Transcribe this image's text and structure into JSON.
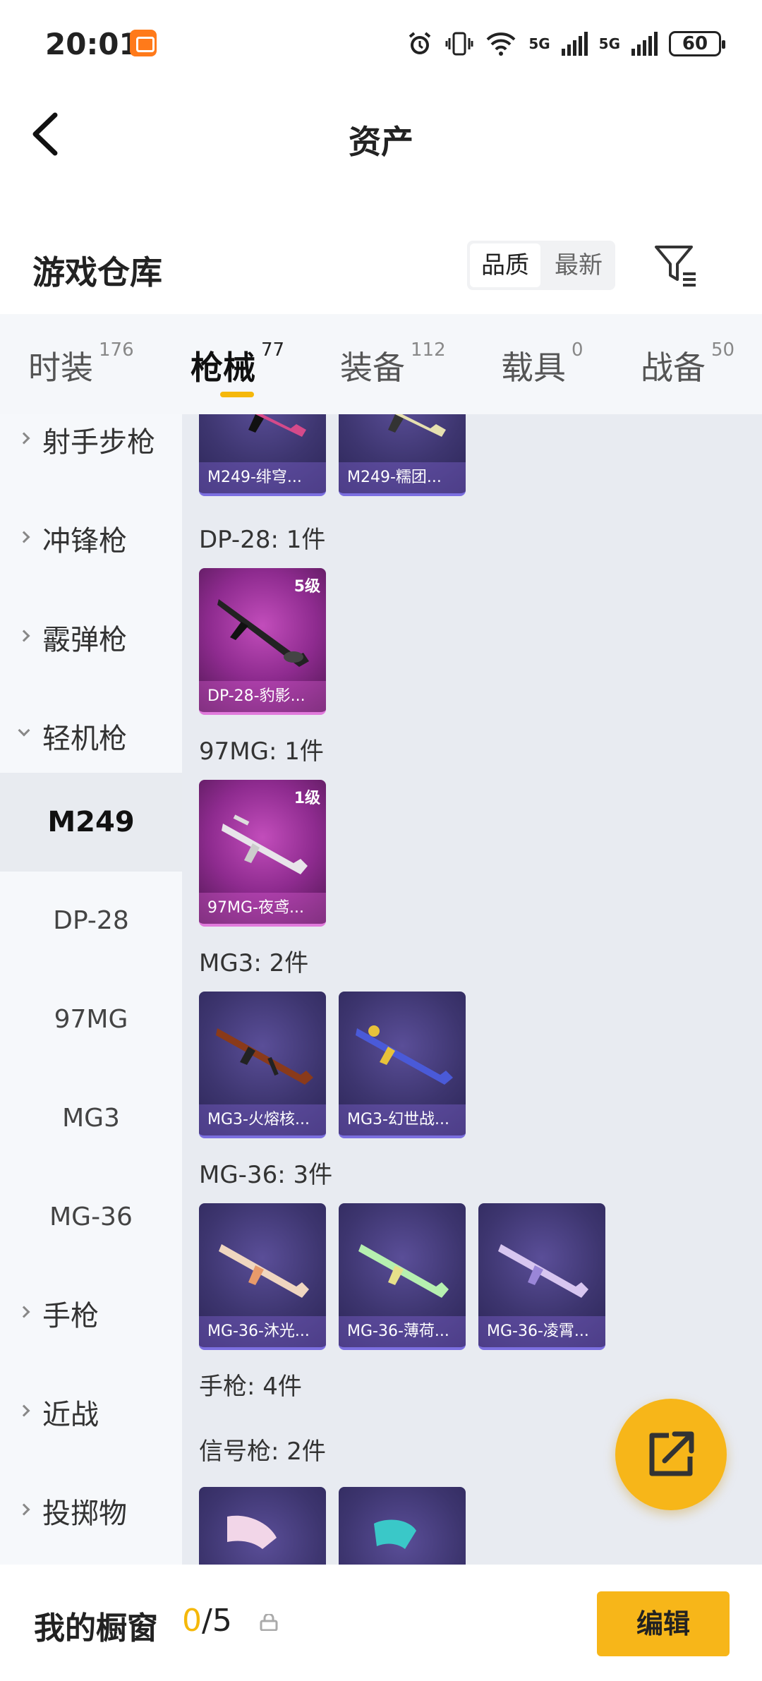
{
  "status_bar": {
    "time": "20:01",
    "network": "5G",
    "network2": "5G",
    "battery": "60"
  },
  "header": {
    "title": "资产"
  },
  "section": {
    "title": "游戏仓库",
    "sort_quality": "品质",
    "sort_latest": "最新"
  },
  "tabs": [
    {
      "label": "时装",
      "count": "176"
    },
    {
      "label": "枪械",
      "count": "77"
    },
    {
      "label": "装备",
      "count": "112"
    },
    {
      "label": "载具",
      "count": "0"
    },
    {
      "label": "战备",
      "count": "50"
    }
  ],
  "active_tab": "枪械",
  "sidebar": {
    "categories": [
      "射手步枪",
      "冲锋枪",
      "霰弹枪",
      "轻机枪",
      "手枪",
      "近战",
      "投掷物"
    ],
    "subcategories": [
      "M249",
      "DP-28",
      "97MG",
      "MG3",
      "MG-36"
    ],
    "selected_subcategory": "M249"
  },
  "groups": [
    {
      "label": "",
      "items": [
        {
          "name": "M249-绯穹...",
          "level": ""
        },
        {
          "name": "M249-糯团...",
          "level": ""
        }
      ]
    },
    {
      "label": "DP-28: 1件",
      "items": [
        {
          "name": "DP-28-豹影...",
          "level": "5级"
        }
      ]
    },
    {
      "label": "97MG: 1件",
      "items": [
        {
          "name": "97MG-夜鸢...",
          "level": "1级"
        }
      ]
    },
    {
      "label": "MG3: 2件",
      "items": [
        {
          "name": "MG3-火熔核...",
          "level": ""
        },
        {
          "name": "MG3-幻世战...",
          "level": ""
        }
      ]
    },
    {
      "label": "MG-36: 3件",
      "items": [
        {
          "name": "MG-36-沐光...",
          "level": ""
        },
        {
          "name": "MG-36-薄荷...",
          "level": ""
        },
        {
          "name": "MG-36-凌霄...",
          "level": ""
        }
      ]
    },
    {
      "label": "手枪: 4件",
      "items": []
    },
    {
      "label": "信号枪: 2件",
      "items": [
        {
          "name": "",
          "level": ""
        },
        {
          "name": "",
          "level": ""
        }
      ]
    }
  ],
  "bottom_bar": {
    "title": "我的橱窗",
    "count_current": "0",
    "count_sep_total": "/5",
    "edit_label": "编辑"
  },
  "colors": {
    "accent": "#f7b619",
    "card_purple": "#3d356f",
    "card_pink": "#8e2b8f"
  }
}
